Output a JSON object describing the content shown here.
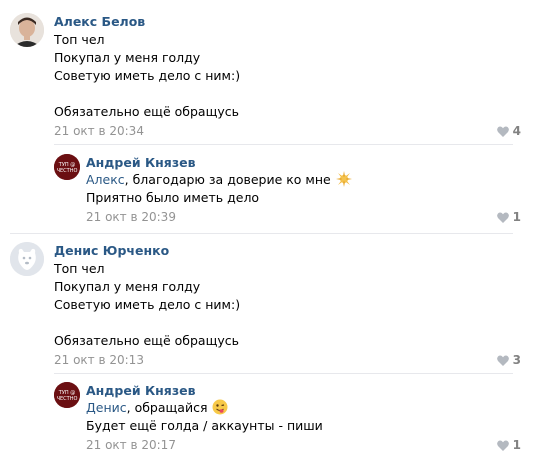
{
  "comments": [
    {
      "author": "Алекс Белов",
      "lines": [
        "Топ чел",
        "Покупал у меня голду",
        "Советую иметь дело с ним:)",
        "",
        "Обязательно ещё обращусь"
      ],
      "date": "21 окт в 20:34",
      "likes": "4",
      "reply": {
        "author": "Андрей Князев",
        "mention": "Алекс",
        "line1_rest": ", благодарю за доверие ко мне",
        "line2": "Приятно было иметь дело",
        "date": "21 окт в 20:39",
        "likes": "1",
        "emoji": "sparkle-emoji"
      }
    },
    {
      "author": "Денис Юрченко",
      "lines": [
        "Топ чел",
        "Покупал у меня голду",
        "Советую иметь дело с ним:)",
        "",
        "Обязательно ещё обращусь"
      ],
      "date": "21 окт в 20:13",
      "likes": "3",
      "reply": {
        "author": "Андрей Князев",
        "mention": "Денис",
        "line1_rest": ", обращайся",
        "line2": "Будет ещё голда / аккаунты - пиши",
        "date": "21 окт в 20:17",
        "likes": "1",
        "emoji": "winking-tongue-emoji"
      }
    }
  ],
  "avatar_badge_text": "ТУП @ ЧЕСТНО",
  "colors": {
    "link": "#2a5885",
    "muted": "#939393",
    "like": "#828282",
    "divider": "#e7e8ec"
  }
}
